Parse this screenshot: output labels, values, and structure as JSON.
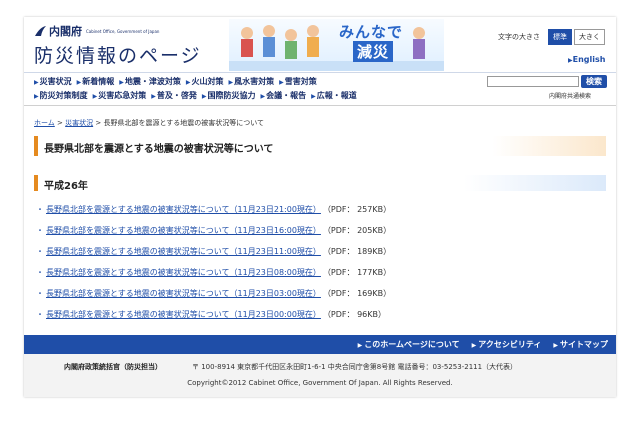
{
  "header": {
    "org": "内閣府",
    "org_en": "Cabinet Office, Government of Japan",
    "site_title": "防災情報のページ",
    "banner_line1": "みんなで",
    "banner_line2": "減災",
    "fontsize_label": "文字の大きさ",
    "fontsize_standard": "標準",
    "fontsize_large": "大きく",
    "english": "English"
  },
  "nav": {
    "row1": [
      "災害状況",
      "新着情報",
      "地震・津波対策",
      "火山対策",
      "風水害対策",
      "雪害対策"
    ],
    "row2": [
      "防災対策制度",
      "災害応急対策",
      "普及・啓発",
      "国際防災協力",
      "会議・報告",
      "広報・報道"
    ],
    "search_button": "検索",
    "common_search": "内閣府共通検索"
  },
  "breadcrumb": {
    "home": "ホーム",
    "sep1": " > ",
    "disaster": "災害状況",
    "sep2": " > ",
    "current": "長野県北部を震源とする地震の被害状況等について"
  },
  "page_title": "長野県北部を震源とする地震の被害状況等について",
  "year_heading": "平成26年",
  "reports": [
    {
      "title": "長野県北部を震源とする地震の被害状況等について（11月23日21:00現在）",
      "size": "（PDF： 257KB）"
    },
    {
      "title": "長野県北部を震源とする地震の被害状況等について（11月23日16:00現在）",
      "size": "（PDF： 205KB）"
    },
    {
      "title": "長野県北部を震源とする地震の被害状況等について（11月23日11:00現在）",
      "size": "（PDF： 189KB）"
    },
    {
      "title": "長野県北部を震源とする地震の被害状況等について（11月23日08:00現在）",
      "size": "（PDF： 177KB）"
    },
    {
      "title": "長野県北部を震源とする地震の被害状況等について（11月23日03:00現在）",
      "size": "（PDF： 169KB）"
    },
    {
      "title": "長野県北部を震源とする地震の被害状況等について（11月23日00:00現在）",
      "size": "（PDF： 96KB）"
    }
  ],
  "footer": {
    "links": [
      "このホームページについて",
      "アクセシビリティ",
      "サイトマップ"
    ],
    "org": "内閣府政策統括官（防災担当）",
    "address": "〒 100-8914 東京都千代田区永田町1-6-1 中央合同庁舎第8号館 電話番号：03-5253-2111（大代表）",
    "copyright": "Copyright©2012 Cabinet Office, Government Of Japan. All Rights Reserved."
  },
  "colors": {
    "brand": "#1f4ea8",
    "accent": "#e58a1f"
  }
}
